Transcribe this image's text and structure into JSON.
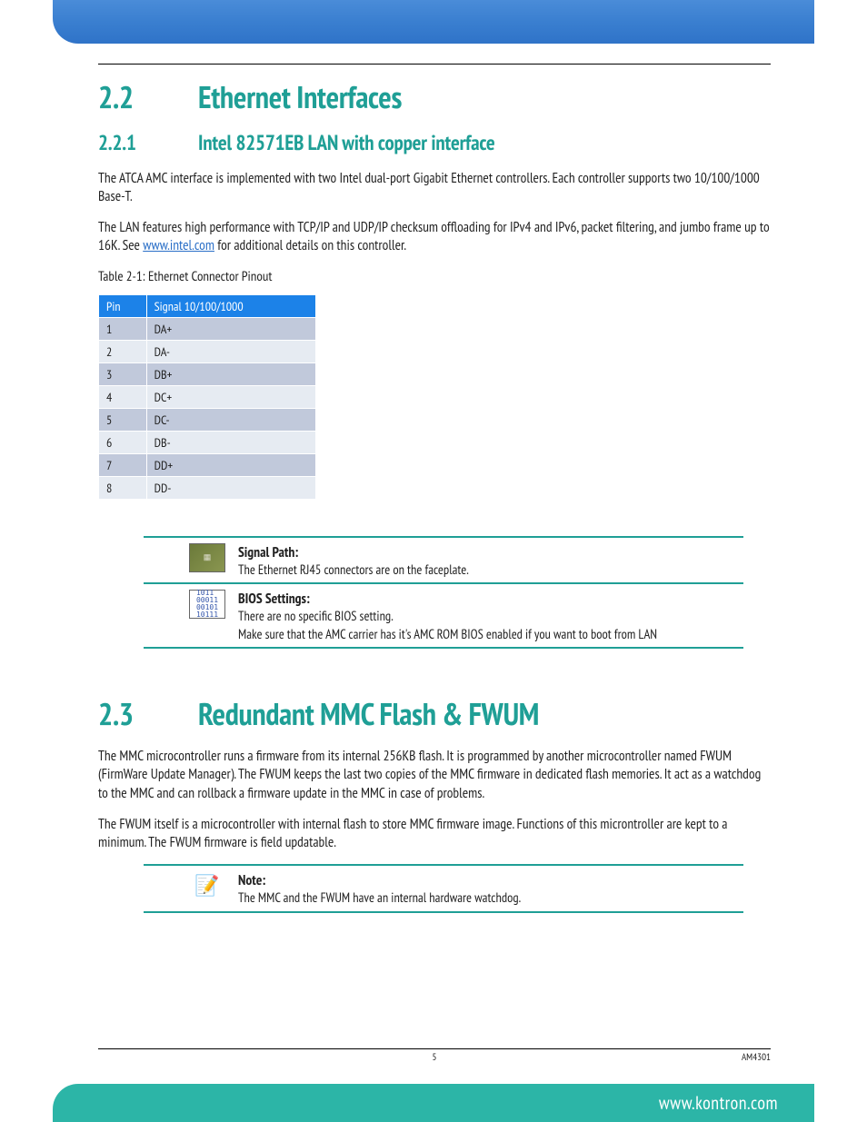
{
  "section22": {
    "num": "2.2",
    "title": "Ethernet Interfaces"
  },
  "section221": {
    "num": "2.2.1",
    "title": "Intel 82571EB LAN with copper interface"
  },
  "para1": "The ATCA AMC interface is implemented with two Intel dual-port Gigabit Ethernet controllers. Each controller supports two 10/100/1000 Base-T.",
  "para2a": "The LAN features high performance with TCP/IP and UDP/IP checksum offloading for IPv4 and IPv6, packet filtering, and jumbo frame up to 16K. See  ",
  "para2link": "www.intel.com",
  "para2b": " for additional details on this controller.",
  "tableCaption": "Table 2-1: Ethernet Connector Pinout",
  "table": {
    "headers": [
      "Pin",
      "Signal 10/100/1000"
    ],
    "rows": [
      [
        "1",
        "DA+"
      ],
      [
        "2",
        "DA-"
      ],
      [
        "3",
        "DB+"
      ],
      [
        "4",
        "DC+"
      ],
      [
        "5",
        "DC-"
      ],
      [
        "6",
        "DB-"
      ],
      [
        "7",
        "DD+"
      ],
      [
        "8",
        "DD-"
      ]
    ]
  },
  "callout_signal": {
    "title": "Signal Path:",
    "desc": "The Ethernet RJ45 connectors are on the faceplate."
  },
  "callout_bios": {
    "title": "BIOS Settings:",
    "desc1": "There are no specific BIOS setting.",
    "desc2": "Make sure that the AMC carrier has it's AMC ROM BIOS enabled if you want to boot from LAN"
  },
  "section23": {
    "num": "2.3",
    "title": "Redundant MMC Flash & FWUM"
  },
  "para3": "The MMC microcontroller runs a firmware from its internal 256KB flash. It is programmed by another microcontroller named FWUM (FirmWare Update Manager). The FWUM keeps the last two copies of the MMC firmware in dedicated flash memories. It act as a watchdog to the MMC and can rollback a firmware update in the MMC in case of problems.",
  "para4": "The FWUM itself is a microcontroller with internal flash to store MMC firmware image. Functions of this microntroller are kept to a minimum. The FWUM firmware is field updatable.",
  "callout_note": {
    "title": "Note:",
    "desc": "The MMC and the FWUM have an internal hardware watchdog."
  },
  "footer": {
    "page": "5",
    "doc": "AM4301"
  },
  "website": "www.kontron.com",
  "bits_icon": "1011\n00011\n00101\n10111"
}
